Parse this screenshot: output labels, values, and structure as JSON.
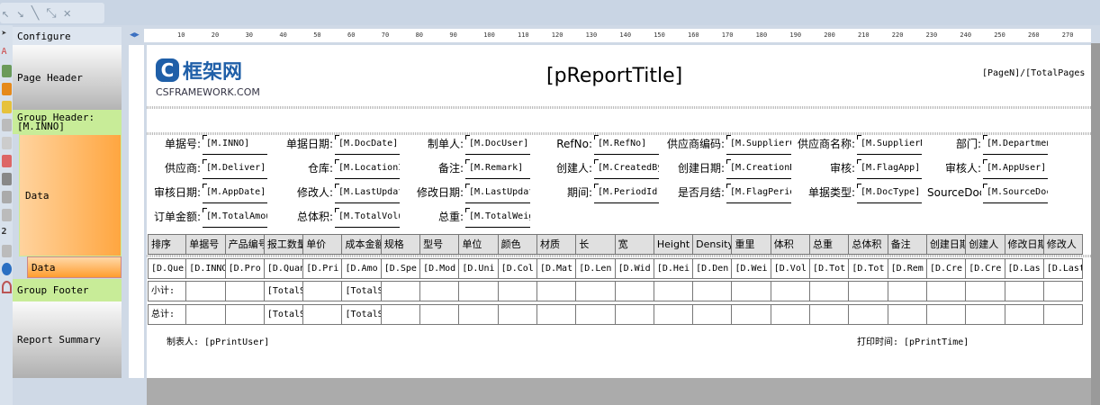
{
  "toolbar": {
    "tools": [
      "pointer-icon",
      "pencil-icon",
      "line-icon",
      "connector-icon",
      "close-icon"
    ]
  },
  "bands": {
    "configure": "Configure",
    "page_header": "Page Header",
    "group_header": "Group Header: [M.INNO]",
    "data": "Data",
    "data_inner": "Data",
    "group_footer": "Group Footer",
    "report_summary": "Report Summary"
  },
  "ruler": {
    "ticks": [
      "10",
      "20",
      "30",
      "40",
      "50",
      "60",
      "70",
      "80",
      "90",
      "100",
      "110",
      "120",
      "130",
      "140",
      "150",
      "160",
      "170",
      "180",
      "190",
      "200",
      "210",
      "220",
      "230",
      "240",
      "250",
      "260",
      "270"
    ]
  },
  "header": {
    "logo_text": "框架网",
    "logo_sub": "CSFRAMEWORK.COM",
    "title": "[pReportTitle]",
    "page_info": "[PageN]/[TotalPages"
  },
  "fields": [
    [
      [
        "单据号:",
        "[M.INNO]"
      ],
      [
        "单据日期:",
        "[M.DocDate]"
      ],
      [
        "制单人:",
        "[M.DocUser]"
      ],
      [
        "RefNo:",
        "[M.RefNo]"
      ],
      [
        "供应商编码:",
        "[M.SupplierCode"
      ],
      [
        "供应商名称:",
        "[M.SupplierName"
      ],
      [
        "部门:",
        "[M.Department"
      ]
    ],
    [
      [
        "供应商:",
        "[M.Deliver]"
      ],
      [
        "仓库:",
        "[M.LocationId"
      ],
      [
        "备注:",
        "[M.Remark]"
      ],
      [
        "创建人:",
        "[M.CreatedBy"
      ],
      [
        "创建日期:",
        "[M.CreationDate"
      ],
      [
        "审核:",
        "[M.FlagApp]"
      ],
      [
        "审核人:",
        "[M.AppUser]"
      ]
    ],
    [
      [
        "审核日期:",
        "[M.AppDate]"
      ],
      [
        "修改人:",
        "[M.LastUpdatedBy"
      ],
      [
        "修改日期:",
        "[M.LastUpdateDate"
      ],
      [
        "期间:",
        "[M.PeriodId]"
      ],
      [
        "是否月结:",
        "[M.FlagPeriod"
      ],
      [
        "单据类型:",
        "[M.DocType]"
      ],
      [
        "SourceDocNo:",
        "[M.SourceDoc]"
      ]
    ],
    [
      [
        "订单金额:",
        "[M.TotalAmount"
      ],
      [
        "总体积:",
        "[M.TotalVolume"
      ],
      [
        "总重:",
        "[M.TotalWeight"
      ]
    ]
  ],
  "table": {
    "headers": [
      "排序",
      "单据号",
      "产品编号",
      "报工数量",
      "单价",
      "成本金额",
      "规格",
      "型号",
      "单位",
      "颜色",
      "材质",
      "长",
      "宽",
      "Height",
      "Density",
      "重里",
      "体积",
      "总重",
      "总体积",
      "备注",
      "创建日期",
      "创建人",
      "修改日期",
      "修改人"
    ],
    "data_row": [
      "[D.Quer",
      "[D.INNO",
      "[D.Pro",
      "[D.Quan",
      "[D.Pri",
      "[D.Amo",
      "[D.Spe",
      "[D.Mod",
      "[D.Uni",
      "[D.Col",
      "[D.Mat",
      "[D.Len",
      "[D.Wid",
      "[D.Hei",
      "[D.Den",
      "[D.Wei",
      "[D.Vol",
      "[D.Tot",
      "[D.Tot",
      "[D.Rem",
      "[D.Cre",
      "[D.Cre",
      "[D.Las",
      "[D.Last"
    ],
    "subtotal_row": [
      "小计:",
      "",
      "",
      "[TotalS",
      "",
      "[TotalS",
      "",
      "",
      "",
      "",
      "",
      "",
      "",
      "",
      "",
      "",
      "",
      "",
      "",
      "",
      "",
      "",
      "",
      ""
    ],
    "total_row": [
      "总计:",
      "",
      "",
      "[TotalS",
      "",
      "[TotalS",
      "",
      "",
      "",
      "",
      "",
      "",
      "",
      "",
      "",
      "",
      "",
      "",
      "",
      "",
      "",
      "",
      "",
      ""
    ]
  },
  "summary": {
    "print_user": "制表人: [pPrintUser]",
    "print_time": "打印时间: [pPrintTime]"
  },
  "colors": {
    "page_header": "#c8c8c8",
    "group_band": "#c8ec98",
    "data_band": "#ffb15a",
    "logo": "#1f5fa8"
  }
}
